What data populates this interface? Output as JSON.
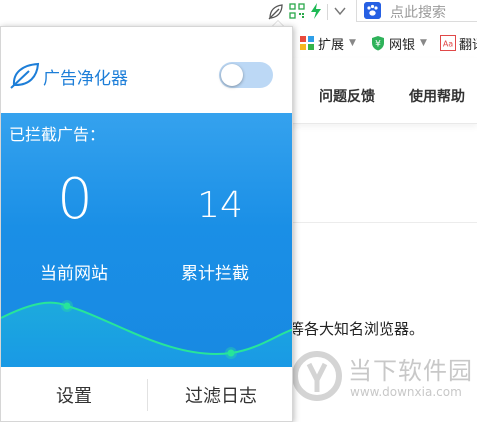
{
  "toolbar": {
    "icons": [
      "leaf-icon",
      "qr-code-icon",
      "lightning-icon",
      "chevron-down-icon"
    ],
    "search_placeholder": "点此搜索",
    "search_logo_icon": "paw-logo-icon"
  },
  "bookmarks": [
    {
      "label": "扩展",
      "icon": "puzzle-icon",
      "has_caret": true
    },
    {
      "label": "网银",
      "icon": "yuan-shield-icon",
      "has_caret": true
    },
    {
      "label": "翻译",
      "icon": "translate-icon",
      "has_caret": false
    }
  ],
  "nav": {
    "feedback": "问题反馈",
    "help": "使用帮助"
  },
  "page": {
    "body_text": "等各大知名浏览器。"
  },
  "watermark": {
    "title": "当下软件园",
    "url": "www.downxia.com"
  },
  "popup": {
    "title": "广告净化器",
    "toggle_on": false,
    "section_label": "已拦截广告：",
    "stats": [
      {
        "value": "0",
        "label": "当前网站"
      },
      {
        "value": "14",
        "label": "累计拦截"
      }
    ],
    "footer": {
      "settings": "设置",
      "filter_log": "过滤日志"
    }
  },
  "colors": {
    "accent": "#1d7ed8",
    "panel_blue": "#1a8fe6",
    "wave_line": "#27e59a",
    "toggle_off": "#bcd8f5"
  }
}
